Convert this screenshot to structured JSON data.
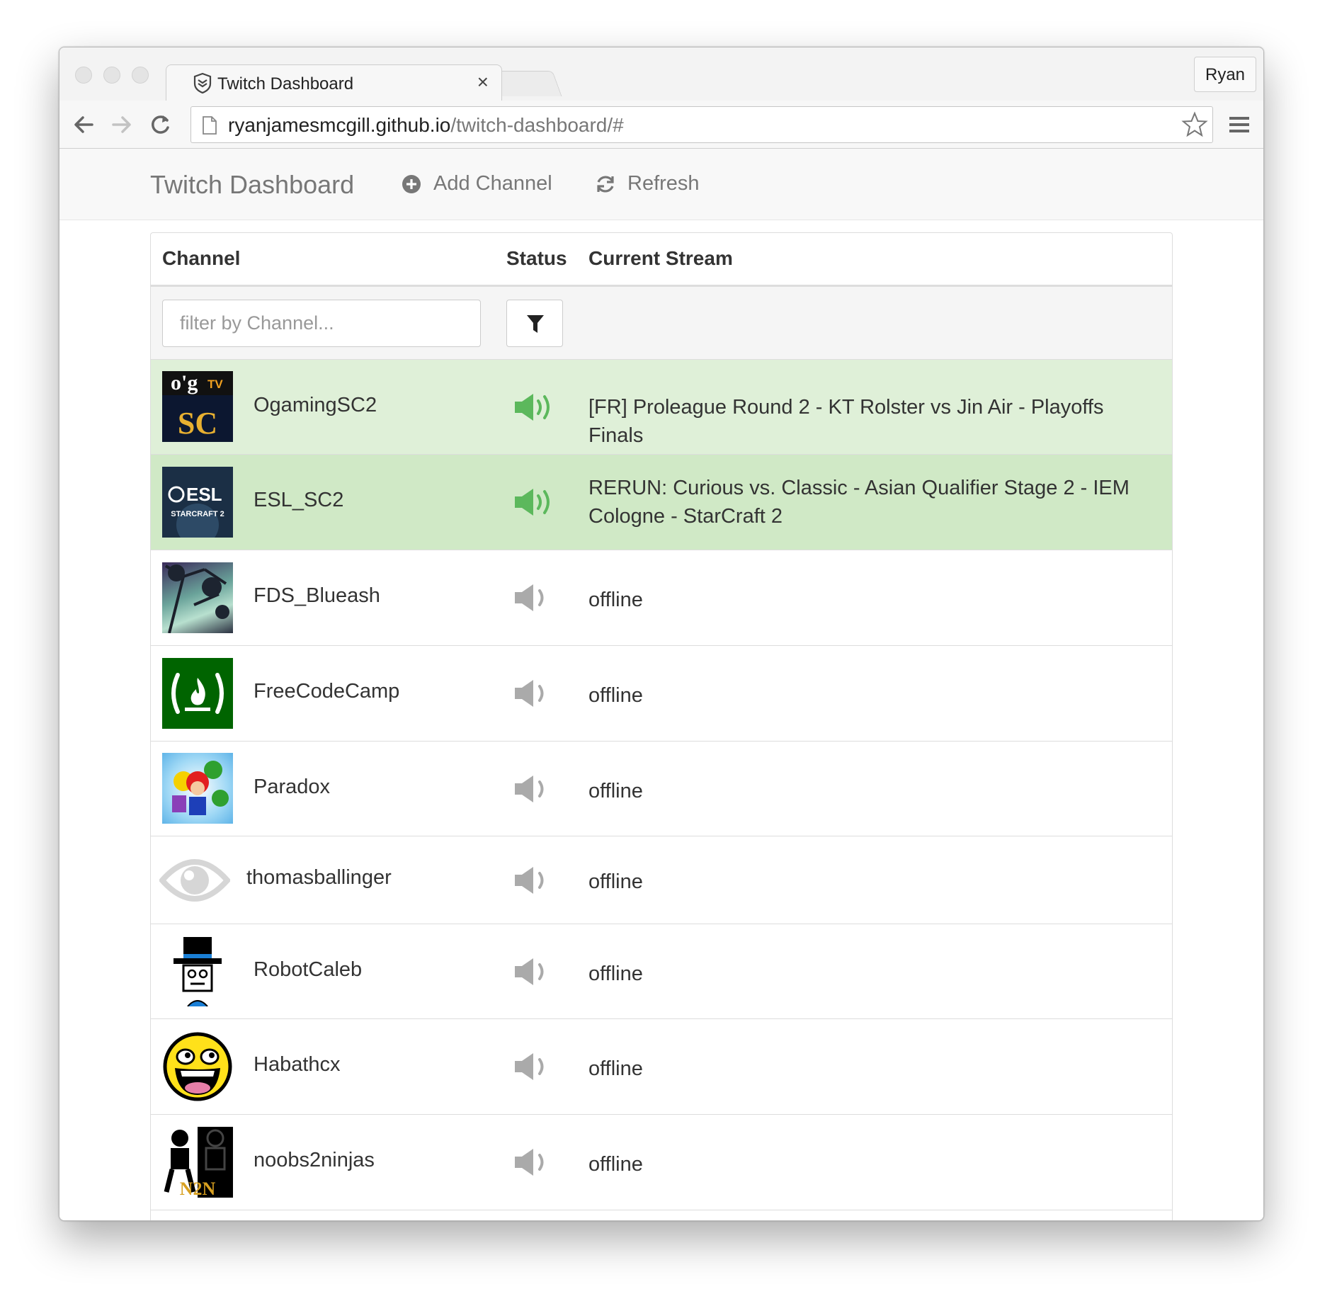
{
  "browser": {
    "tab_title": "Twitch Dashboard",
    "tab_close": "×",
    "profile_name": "Ryan",
    "url_host": "ryanjamesmcgill.github.io",
    "url_path": "/twitch-dashboard/#"
  },
  "navbar": {
    "brand": "Twitch Dashboard",
    "add_channel": "Add Channel",
    "refresh": "Refresh"
  },
  "table": {
    "headers": {
      "channel": "Channel",
      "status": "Status",
      "current_stream": "Current Stream"
    },
    "filter_placeholder": "filter by Channel...",
    "rows": [
      {
        "channel": "OgamingSC2",
        "status": "online",
        "stream": "[FR] Proleague Round 2 - KT Rolster vs Jin Air - Playoffs Finals"
      },
      {
        "channel": "ESL_SC2",
        "status": "online",
        "stream": "RERUN: Curious vs. Classic - Asian Qualifier Stage 2 - IEM Cologne - StarCraft 2"
      },
      {
        "channel": "FDS_Blueash",
        "status": "offline",
        "stream": "offline"
      },
      {
        "channel": "FreeCodeCamp",
        "status": "offline",
        "stream": "offline"
      },
      {
        "channel": "Paradox",
        "status": "offline",
        "stream": "offline"
      },
      {
        "channel": "thomasballinger",
        "status": "offline",
        "stream": "offline"
      },
      {
        "channel": "RobotCaleb",
        "status": "offline",
        "stream": "offline"
      },
      {
        "channel": "Habathcx",
        "status": "offline",
        "stream": "offline"
      },
      {
        "channel": "noobs2ninjas",
        "status": "offline",
        "stream": "offline"
      }
    ]
  },
  "avatar_text": {
    "ogtv_logo": "o'g",
    "ogtv_tv": "TV",
    "ogtv_sc": "SC",
    "esl_logo": "ESL",
    "esl_sub": "STARCRAFT 2",
    "n2n_logo": "N2N"
  },
  "colors": {
    "live_row": "#dff0d8",
    "live_row_alt": "#d0e9c6",
    "live_speaker": "#5cb85c",
    "offline_speaker": "#aaaaaa",
    "freecodecamp_green": "#006400"
  }
}
